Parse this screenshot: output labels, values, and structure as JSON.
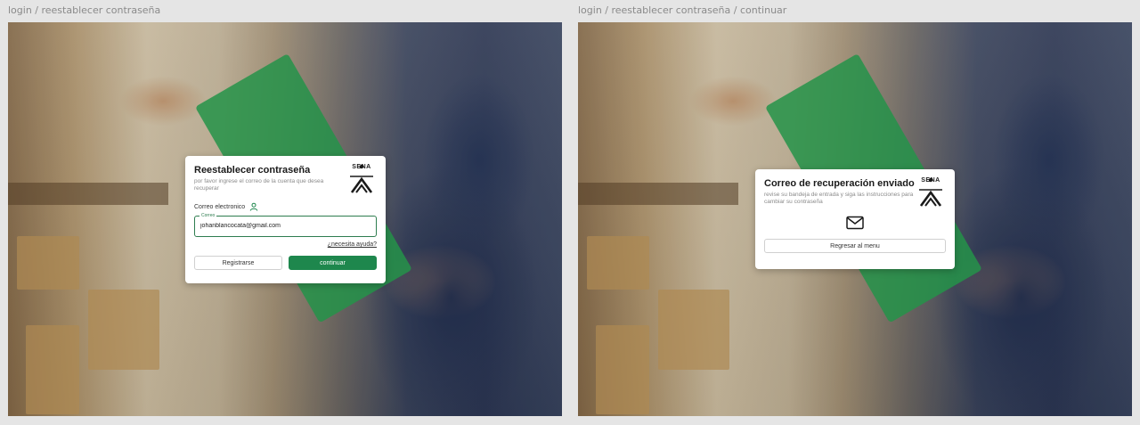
{
  "frames": [
    {
      "label": "login / reestablecer contraseña",
      "card": {
        "title": "Reestablecer contraseña",
        "subtitle": "por favor ingrese el correo de la cuenta que desea recuperar",
        "logo_text": "SENA",
        "field_label": "Correo electronico",
        "input_float_label": "Correo",
        "input_value": "johanblancocata@gmail.com",
        "help_link": "¿necesita ayuda?",
        "secondary_button": "Registrarse",
        "primary_button": "continuar"
      }
    },
    {
      "label": "login / reestablecer contraseña / continuar",
      "card": {
        "title": "Correo de recuperación enviado",
        "subtitle": "revise su bandeja de entrada y siga las instrucciones para cambiar su contraseña",
        "logo_text": "SENA",
        "button": "Regresar al menu"
      }
    }
  ],
  "colors": {
    "primary_green": "#1e874d",
    "input_border": "#2e7d4f",
    "canvas_bg": "#e5e5e5"
  },
  "icons": [
    "user-icon",
    "mail-icon",
    "sena-logo"
  ]
}
